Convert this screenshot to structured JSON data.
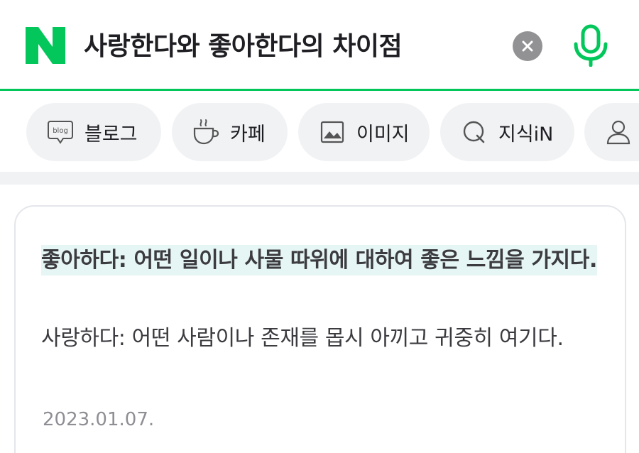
{
  "header": {
    "logo_letter": "N",
    "query": "사랑한다와 좋아한다의 차이점",
    "clear_icon": "close-icon",
    "mic_icon": "microphone-icon"
  },
  "tabs": [
    {
      "label": "블로그",
      "icon": "blog-icon"
    },
    {
      "label": "카페",
      "icon": "cup-icon"
    },
    {
      "label": "이미지",
      "icon": "image-icon"
    },
    {
      "label": "지식iN",
      "icon": "q-icon"
    },
    {
      "label": "",
      "icon": "person-icon"
    }
  ],
  "result": {
    "highlight_text": "좋아하다: 어떤 일이나 사물 따위에 대하여 좋은 느낌을 가지다.",
    "body_text": "사랑하다: 어떤 사람이나 존재를 몹시 아끼고 귀중히 여기다.",
    "date": "2023.01.07."
  },
  "colors": {
    "brand_green": "#03c75a",
    "highlight_bg": "#e6f6f4",
    "tab_bg": "#f1f2f4",
    "clear_btn_bg": "#929294"
  }
}
